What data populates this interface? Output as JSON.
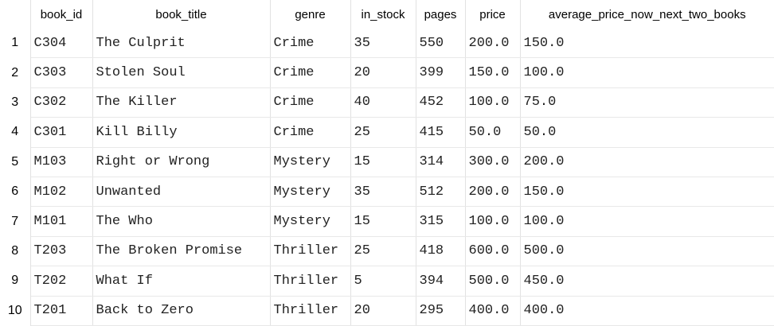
{
  "table": {
    "columns": [
      "book_id",
      "book_title",
      "genre",
      "in_stock",
      "pages",
      "price",
      "average_price_now_next_two_books"
    ],
    "rows": [
      {
        "num": "1",
        "cells": [
          "C304",
          "The Culprit",
          "Crime",
          "35",
          "550",
          "200.0",
          "150.0"
        ]
      },
      {
        "num": "2",
        "cells": [
          "C303",
          "Stolen Soul",
          "Crime",
          "20",
          "399",
          "150.0",
          "100.0"
        ]
      },
      {
        "num": "3",
        "cells": [
          "C302",
          "The Killer",
          "Crime",
          "40",
          "452",
          "100.0",
          "75.0"
        ]
      },
      {
        "num": "4",
        "cells": [
          "C301",
          "Kill Billy",
          "Crime",
          "25",
          "415",
          "50.0",
          "50.0"
        ]
      },
      {
        "num": "5",
        "cells": [
          "M103",
          "Right or Wrong",
          "Mystery",
          "15",
          "314",
          "300.0",
          "200.0"
        ]
      },
      {
        "num": "6",
        "cells": [
          "M102",
          "Unwanted",
          "Mystery",
          "35",
          "512",
          "200.0",
          "150.0"
        ]
      },
      {
        "num": "7",
        "cells": [
          "M101",
          "The Who",
          "Mystery",
          "15",
          "315",
          "100.0",
          "100.0"
        ]
      },
      {
        "num": "8",
        "cells": [
          "T203",
          "The Broken Promise",
          "Thriller",
          "25",
          "418",
          "600.0",
          "500.0"
        ]
      },
      {
        "num": "9",
        "cells": [
          "T202",
          "What If",
          "Thriller",
          "5",
          "394",
          "500.0",
          "450.0"
        ]
      },
      {
        "num": "10",
        "cells": [
          "T201",
          "Back to Zero",
          "Thriller",
          "20",
          "295",
          "400.0",
          "400.0"
        ]
      }
    ]
  }
}
